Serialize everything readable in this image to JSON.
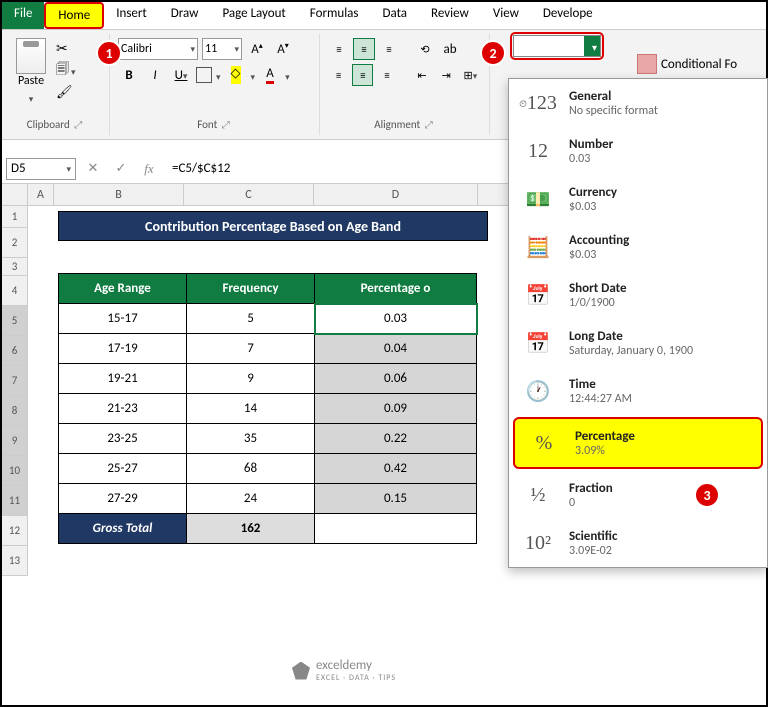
{
  "tabs": {
    "file": "File",
    "home": "Home",
    "insert": "Insert",
    "draw": "Draw",
    "pagelayout": "Page Layout",
    "formulas": "Formulas",
    "data": "Data",
    "review": "Review",
    "view": "View",
    "developer": "Develope"
  },
  "ribbon": {
    "paste": "Paste",
    "clipboard_label": "Clipboard",
    "font_name": "Calibri",
    "font_size": "11",
    "font_label": "Font",
    "alignment_label": "Alignment",
    "wrap": "ab",
    "cond_fmt": "Conditional Fo"
  },
  "format_dropdown": {
    "items": [
      {
        "icon": "123",
        "name": "General",
        "sample": "No specific format"
      },
      {
        "icon": "12",
        "name": "Number",
        "sample": "0.03"
      },
      {
        "icon": "cur",
        "name": "Currency",
        "sample": "$0.03"
      },
      {
        "icon": "acc",
        "name": "Accounting",
        "sample": " $0.03"
      },
      {
        "icon": "sdate",
        "name": "Short Date",
        "sample": "1/0/1900"
      },
      {
        "icon": "ldate",
        "name": "Long Date",
        "sample": "Saturday, January 0, 1900"
      },
      {
        "icon": "time",
        "name": "Time",
        "sample": "12:44:27 AM"
      },
      {
        "icon": "%",
        "name": "Percentage",
        "sample": "3.09%"
      },
      {
        "icon": "½",
        "name": "Fraction",
        "sample": "0"
      },
      {
        "icon": "10²",
        "name": "Scientific",
        "sample": "3.09E-02"
      }
    ]
  },
  "namebox": "D5",
  "formula": "=C5/$C$12",
  "cols": {
    "A": "A",
    "B": "B",
    "C": "C",
    "D": "D"
  },
  "rowlabels": [
    "1",
    "2",
    "3",
    "4",
    "5",
    "6",
    "7",
    "8",
    "9",
    "10",
    "11",
    "12",
    "13"
  ],
  "title": "Contribution Percentage Based on Age Band",
  "table": {
    "headers": {
      "range": "Age Range",
      "freq": "Frequency",
      "pct": "Percentage o"
    },
    "rows": [
      {
        "range": "15-17",
        "freq": "5",
        "pct": "0.03"
      },
      {
        "range": "17-19",
        "freq": "7",
        "pct": "0.04"
      },
      {
        "range": "19-21",
        "freq": "9",
        "pct": "0.06"
      },
      {
        "range": "21-23",
        "freq": "14",
        "pct": "0.09"
      },
      {
        "range": "23-25",
        "freq": "35",
        "pct": "0.22"
      },
      {
        "range": "25-27",
        "freq": "68",
        "pct": "0.42"
      },
      {
        "range": "27-29",
        "freq": "24",
        "pct": "0.15"
      }
    ],
    "total_label": "Gross Total",
    "total_value": "162"
  },
  "watermark": {
    "name": "exceldemy",
    "sub": "EXCEL · DATA · TIPS"
  },
  "badges": {
    "b1": "1",
    "b2": "2",
    "b3": "3"
  }
}
